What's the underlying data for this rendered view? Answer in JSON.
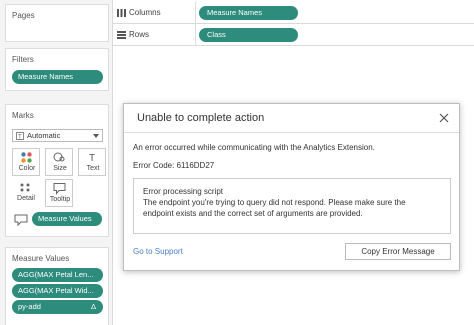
{
  "cards": {
    "pages": {
      "title": "Pages"
    },
    "filters": {
      "title": "Filters",
      "items": [
        "Measure Names"
      ]
    },
    "marks": {
      "title": "Marks",
      "mark_type": "Automatic",
      "buttons": [
        "Color",
        "Size",
        "Text",
        "Detail",
        "Tooltip"
      ],
      "pill": "Measure Values"
    },
    "measure_values": {
      "title": "Measure Values",
      "items": [
        "AGG(MAX Petal Len...",
        "AGG(MAX Petal Wid...",
        "py-add"
      ],
      "delta_symbol": "Δ"
    }
  },
  "shelves": {
    "columns": {
      "label": "Columns",
      "pill": "Measure Names"
    },
    "rows": {
      "label": "Rows",
      "pill": "Class"
    }
  },
  "dialog": {
    "title": "Unable to complete action",
    "message": "An error occurred while communicating with the Analytics Extension.",
    "error_code": "Error Code: 6116DD27",
    "details": [
      "Error processing script",
      "The endpoint you're trying to query did not respond. Please make sure the",
      "endpoint exists and the correct set of arguments are provided."
    ],
    "support_link": "Go to Support",
    "copy_button": "Copy Error Message"
  },
  "colors": {
    "pill": "#2e8c7c",
    "link": "#4a82c5",
    "sidebar_bg": "#f4f4f4"
  },
  "icons": [
    "columns-icon",
    "rows-icon",
    "color-icon",
    "size-icon",
    "text-icon",
    "detail-icon",
    "tooltip-icon",
    "close-icon",
    "dropdown-icon"
  ]
}
